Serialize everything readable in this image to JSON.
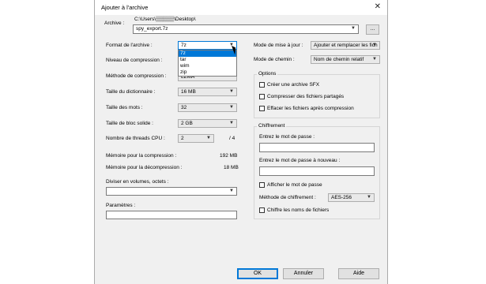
{
  "window": {
    "title": "Ajouter à l'archive",
    "close_glyph": "✕"
  },
  "archive": {
    "label": "Archive :",
    "path": "C:\\Users\\▒▒▒▒▒\\Desktop\\",
    "value": "spy_export.7z",
    "browse_label": "..."
  },
  "format": {
    "label": "Format de l'archive :",
    "value": "7z",
    "options": [
      "7z",
      "tar",
      "wim",
      "zip"
    ]
  },
  "compression_level": {
    "label": "Niveau de compression :"
  },
  "compression_method": {
    "label": "Méthode de compression :",
    "value": "LZMA"
  },
  "dictionary_size": {
    "label": "Taille du dictionnaire :",
    "value": "16 MB"
  },
  "word_size": {
    "label": "Taille des mots :",
    "value": "32"
  },
  "solid_block": {
    "label": "Taille de bloc solide :",
    "value": "2 GB"
  },
  "threads": {
    "label": "Nombre de threads CPU :",
    "value": "2",
    "max": "/ 4"
  },
  "memory": {
    "compress_label": "Mémoire pour la compression :",
    "compress_value": "192 MB",
    "decompress_label": "Mémoire pour la décompression :",
    "decompress_value": "18 MB"
  },
  "split": {
    "label": "Diviser en volumes, octets :",
    "value": ""
  },
  "params": {
    "label": "Paramètres :",
    "value": ""
  },
  "update_mode": {
    "label": "Mode de mise à jour :",
    "value": "Ajouter et remplacer les fich"
  },
  "path_mode": {
    "label": "Mode de chemin :",
    "value": "Nom de chemin relatif"
  },
  "options": {
    "title": "Options",
    "sfx": "Créer une archive SFX",
    "shared": "Compresser des fichiers partagés",
    "delete": "Effacer les fichiers après compression"
  },
  "encryption": {
    "title": "Chiffrement",
    "pwd_label": "Entrez le mot de passe :",
    "pwd_again_label": "Entrez le mot de passe à nouveau :",
    "show_pwd": "Afficher le mot de passe",
    "method_label": "Méthode de chiffrement :",
    "method_value": "AES-256",
    "encrypt_names": "Chiffre les noms de fichiers"
  },
  "buttons": {
    "ok": "OK",
    "cancel": "Annuler",
    "help": "Aide"
  },
  "icons": {
    "dropdown": "▼"
  }
}
